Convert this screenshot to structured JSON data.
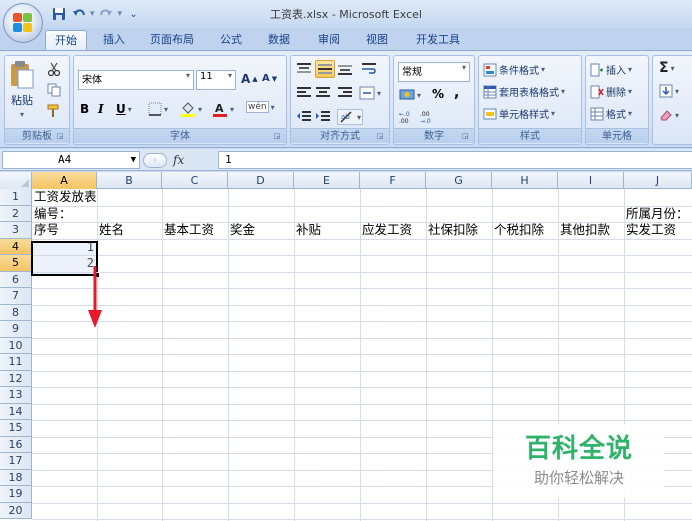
{
  "window": {
    "title": "工资表.xlsx - Microsoft Excel"
  },
  "qat": {
    "icons": [
      "save-icon",
      "undo-icon",
      "redo-icon",
      "customize-icon"
    ]
  },
  "tabs": [
    {
      "label": "开始",
      "active": true
    },
    {
      "label": "插入"
    },
    {
      "label": "页面布局"
    },
    {
      "label": "公式"
    },
    {
      "label": "数据"
    },
    {
      "label": "审阅"
    },
    {
      "label": "视图"
    },
    {
      "label": "开发工具"
    }
  ],
  "ribbon": {
    "clipboard": {
      "label": "剪贴板",
      "paste_label": "粘贴"
    },
    "font": {
      "label": "字体",
      "font_name": "宋体",
      "font_size": "11",
      "bold": "B",
      "italic": "I",
      "underline": "U",
      "grow": "A",
      "shrink": "A",
      "phonetic": "wén"
    },
    "alignment": {
      "label": "对齐方式"
    },
    "number": {
      "label": "数字",
      "format": "常规",
      "percent": "%",
      "comma": ","
    },
    "styles": {
      "label": "样式",
      "conditional": "条件格式",
      "table": "套用表格格式",
      "cell_styles": "单元格样式"
    },
    "cells": {
      "label": "单元格",
      "insert": "插入",
      "delete": "删除",
      "format": "格式"
    },
    "editing": {
      "sum": "Σ"
    }
  },
  "formula_bar": {
    "name_box": "A4",
    "fx": "fx",
    "content": "1"
  },
  "grid": {
    "columns": [
      "A",
      "B",
      "C",
      "D",
      "E",
      "F",
      "G",
      "H",
      "I",
      "J"
    ],
    "selected_column": "A",
    "rows": [
      "1",
      "2",
      "3",
      "4",
      "5",
      "6",
      "7",
      "8",
      "9",
      "10",
      "11",
      "12",
      "13",
      "14",
      "15",
      "16",
      "17",
      "18",
      "19",
      "20"
    ],
    "selected_rows": [
      "4",
      "5"
    ],
    "cells": {
      "r1": {
        "A": "工资发放表"
      },
      "r2": {
        "A": "编号：",
        "J": "所属月份："
      },
      "r3": {
        "A": "序号",
        "B": "姓名",
        "C": "基本工资",
        "D": "奖金",
        "E": "补贴",
        "F": "应发工资",
        "G": "社保扣除",
        "H": "个税扣除",
        "I": "其他扣款",
        "J": "实发工资"
      },
      "r4": {
        "A": "1"
      },
      "r5": {
        "A": "2"
      }
    }
  },
  "watermark": {
    "title": "百科全说",
    "subtitle": "助你轻松解决"
  },
  "colors": {
    "arrow": "#e8192c",
    "watermark_green": "#2fb36a",
    "selected_header": "#f4c463"
  }
}
